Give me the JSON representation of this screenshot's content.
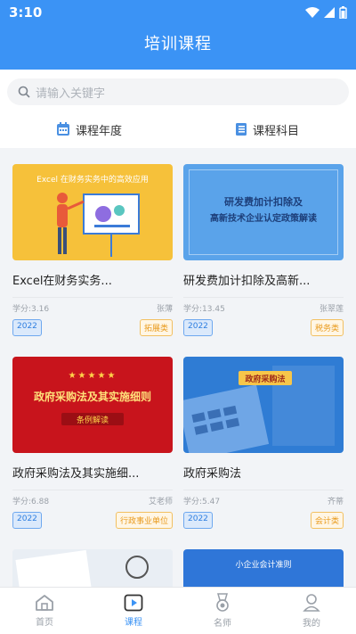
{
  "status_bar": {
    "time": "3:10"
  },
  "header": {
    "title": "培训课程"
  },
  "search": {
    "placeholder": "请输入关键字"
  },
  "filters": [
    {
      "label": "课程年度",
      "icon": "calendar-icon"
    },
    {
      "label": "课程科目",
      "icon": "book-icon"
    }
  ],
  "courses": [
    {
      "thumb_text": "Excel 在财务实务中的高效应用",
      "title": "Excel在财务实务...",
      "credit": "学分:3.16",
      "teacher": "张薄",
      "year": "2022",
      "category": "拓展类"
    },
    {
      "thumb_line1": "研发费加计扣除及",
      "thumb_line2": "高新技术企业认定政策解读",
      "title": "研发费加计扣除及高新...",
      "credit": "学分:13.45",
      "teacher": "张翠莲",
      "year": "2022",
      "category": "税务类"
    },
    {
      "thumb_line1": "政府采购法及其实施细则",
      "thumb_line2": "条例解读",
      "title": "政府采购法及其实施细...",
      "credit": "学分:6.88",
      "teacher": "艾老师",
      "year": "2022",
      "category": "行政事业单位"
    },
    {
      "thumb_text": "政府采购法",
      "title": "政府采购法",
      "credit": "学分:5.47",
      "teacher": "齐蒂",
      "year": "2022",
      "category": "会计类"
    },
    {},
    {
      "thumb_text": "小企业会计准则"
    }
  ],
  "tabs": [
    {
      "label": "首页",
      "icon": "home-icon",
      "active": false
    },
    {
      "label": "课程",
      "icon": "play-icon",
      "active": true
    },
    {
      "label": "名师",
      "icon": "medal-icon",
      "active": false
    },
    {
      "label": "我的",
      "icon": "person-icon",
      "active": false
    }
  ],
  "colors": {
    "primary": "#3b93f5",
    "tag_year": "#2d7ee0",
    "tag_category": "#e99a1c"
  }
}
